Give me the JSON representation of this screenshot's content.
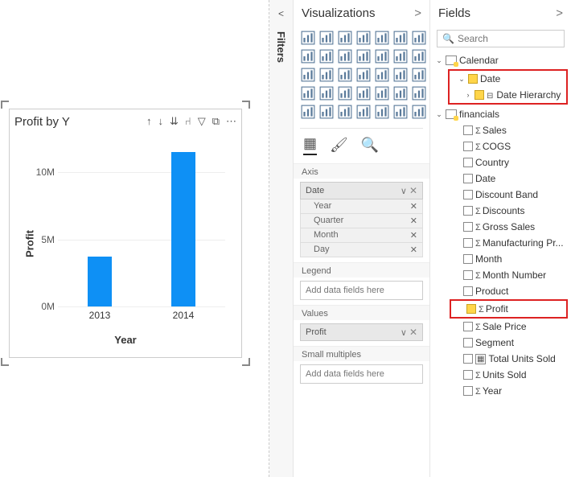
{
  "chart_data": {
    "type": "bar",
    "title": "Profit by Y",
    "xlabel": "Year",
    "ylabel": "Profit",
    "categories": [
      "2013",
      "2014"
    ],
    "values": [
      3700000,
      11500000
    ],
    "ylim": [
      0,
      12000000
    ],
    "yticks": [
      {
        "v": 0,
        "label": "0M"
      },
      {
        "v": 5000000,
        "label": "5M"
      },
      {
        "v": 10000000,
        "label": "10M"
      }
    ]
  },
  "panels": {
    "filters": "Filters",
    "visualizations": "Visualizations",
    "fields": "Fields"
  },
  "search": {
    "placeholder": "Search"
  },
  "wells": {
    "axis": {
      "label": "Axis",
      "chip": "Date",
      "subs": [
        "Year",
        "Quarter",
        "Month",
        "Day"
      ]
    },
    "legend": {
      "label": "Legend",
      "placeholder": "Add data fields here"
    },
    "values": {
      "label": "Values",
      "chip": "Profit"
    },
    "small": {
      "label": "Small multiples",
      "placeholder": "Add data fields here"
    }
  },
  "tree": {
    "tables": [
      {
        "name": "Calendar",
        "expanded": true,
        "highlighted_group": true,
        "fields": [
          {
            "name": "Date",
            "checked": true,
            "highlight": true,
            "indent": 1
          },
          {
            "name": "Date Hierarchy",
            "checked": true,
            "highlight": true,
            "indent": 2,
            "hierarchy": true
          }
        ]
      },
      {
        "name": "financials",
        "expanded": true,
        "fields": [
          {
            "name": "Sales",
            "sigma": true
          },
          {
            "name": "COGS",
            "sigma": true
          },
          {
            "name": "Country"
          },
          {
            "name": "Date"
          },
          {
            "name": "Discount Band"
          },
          {
            "name": "Discounts",
            "sigma": true
          },
          {
            "name": "Gross Sales",
            "sigma": true
          },
          {
            "name": "Manufacturing Pr...",
            "sigma": true
          },
          {
            "name": "Month"
          },
          {
            "name": "Month Number",
            "sigma": true
          },
          {
            "name": "Product"
          },
          {
            "name": "Profit",
            "sigma": true,
            "checked": true,
            "highlight": true
          },
          {
            "name": "Sale Price",
            "sigma": true
          },
          {
            "name": "Segment"
          },
          {
            "name": "Total Units Sold",
            "calc": true
          },
          {
            "name": "Units Sold",
            "sigma": true
          },
          {
            "name": "Year",
            "sigma": true
          }
        ]
      }
    ]
  }
}
